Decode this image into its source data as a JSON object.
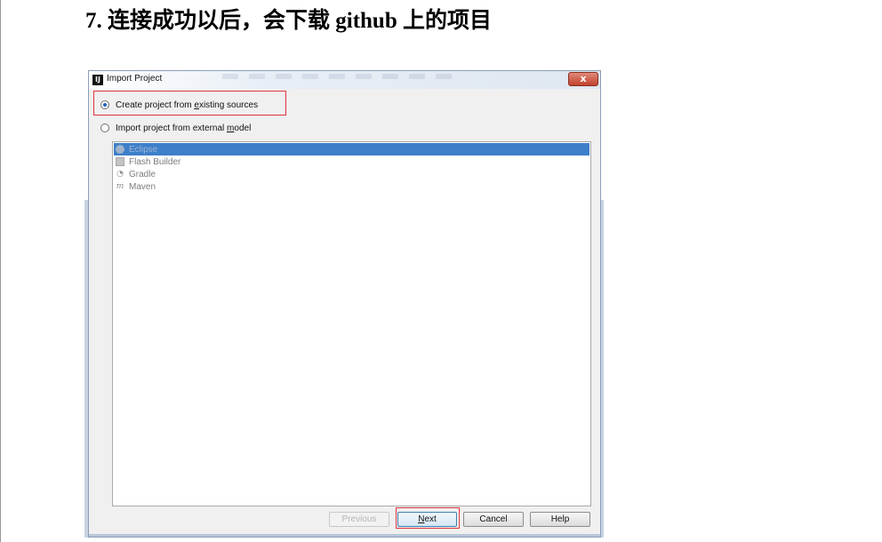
{
  "heading": "7. 连接成功以后，会下载 github 上的项目",
  "dialog": {
    "title": "Import Project",
    "app_icon": "IJ",
    "close_label": "x",
    "options": [
      {
        "pre": "Create project from ",
        "u": "e",
        "post": "xisting sources",
        "selected": true
      },
      {
        "pre": "Import project from external ",
        "u": "m",
        "post": "odel",
        "selected": false
      }
    ],
    "models": [
      {
        "label": "Eclipse",
        "icon": "eclipse-icon",
        "selected": true
      },
      {
        "label": "Flash Builder",
        "icon": "flash-builder-icon",
        "selected": false
      },
      {
        "label": "Gradle",
        "icon": "gradle-icon",
        "selected": false
      },
      {
        "label": "Maven",
        "icon": "maven-icon",
        "selected": false
      }
    ],
    "buttons": {
      "previous": "Previous",
      "next_u": "N",
      "next_rest": "ext",
      "cancel": "Cancel",
      "help": "Help"
    },
    "highlight_color": "#e0343f",
    "selection_color": "#3d7fc9"
  }
}
